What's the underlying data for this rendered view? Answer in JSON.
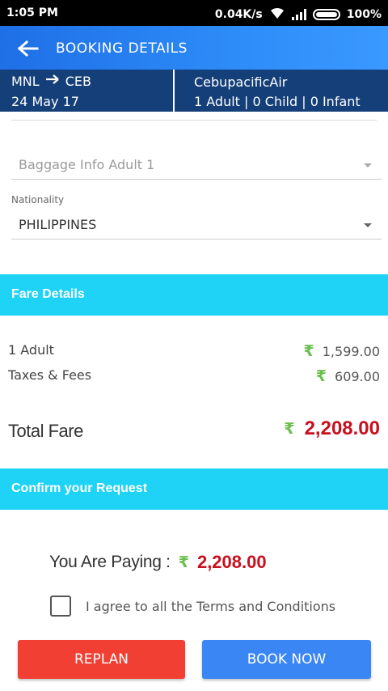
{
  "status_bar": {
    "time": "1:05 PM",
    "network_speed": "0.04K/s",
    "battery": "100%",
    "icons": [
      "wifi-icon",
      "signal-icon",
      "battery-icon"
    ]
  },
  "app_bar": {
    "back_icon": "arrow-left-icon",
    "title": "BOOKING DETAILS"
  },
  "flight": {
    "origin": "MNL",
    "destination": "CEB",
    "route_icon": "arrow-right-icon",
    "date": "24 May 17",
    "airline": "CebupacificAir",
    "passengers": "1 Adult | 0 Child | 0 Infant"
  },
  "form": {
    "baggage_placeholder": "Baggage Info Adult 1",
    "nationality_label": "Nationality",
    "nationality_value": "PHILIPPINES"
  },
  "fare_details": {
    "header": "Fare Details",
    "currency_symbol": "₹",
    "rows": [
      {
        "label": "1 Adult",
        "amount": "1,599.00"
      },
      {
        "label": "Taxes & Fees",
        "amount": "609.00"
      }
    ],
    "total_label": "Total Fare",
    "total_amount": "2,208.00"
  },
  "confirm": {
    "header": "Confirm your Request",
    "paying_label": "You Are Paying :",
    "paying_amount": "2,208.00",
    "terms_text": "I agree to all the Terms and Conditions",
    "terms_checked": false
  },
  "actions": {
    "replan_label": "REPLAN",
    "book_label": "BOOK NOW"
  },
  "colors": {
    "app_bar": "#2d8cf8",
    "flight_strip": "#143f78",
    "section_header": "#1fd3f6",
    "amount_red": "#c8101e",
    "rupee_green": "#6bbf4e",
    "replan_button": "#f23f34",
    "book_button": "#3b86f5"
  }
}
